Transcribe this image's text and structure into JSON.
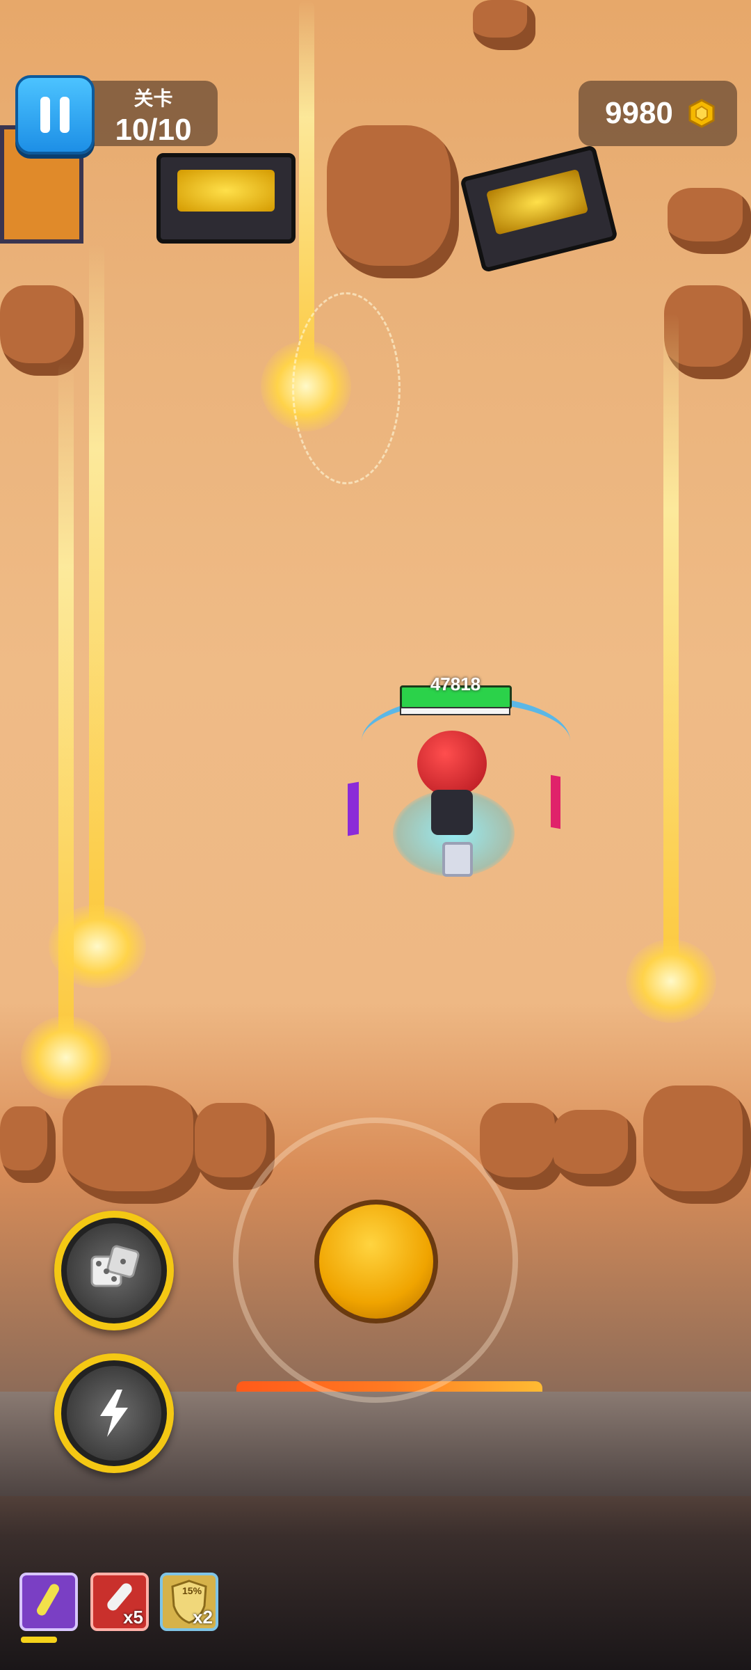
{
  "hud": {
    "level_label": "关卡",
    "level_value": "10/10",
    "coins": "9980"
  },
  "player": {
    "hp_value": "47818",
    "hp_fraction": 1.0
  },
  "abilities": [
    {
      "name": "dice-skill",
      "icon": "dice-icon",
      "cooldown_fraction": 0.55
    },
    {
      "name": "lightning-skill",
      "icon": "lightning-icon",
      "cooldown_fraction": 0.55
    }
  ],
  "inventory": [
    {
      "icon": "potion-icon",
      "count": ""
    },
    {
      "icon": "rocket-icon",
      "count": "x5"
    },
    {
      "icon": "shield-icon",
      "count": "x2",
      "badge": "15%"
    }
  ],
  "colors": {
    "accent_blue": "#1d8fe6",
    "coin_gold": "#f5b800",
    "hp_green": "#2bd24a",
    "joystick_gold": "#f0a400"
  }
}
